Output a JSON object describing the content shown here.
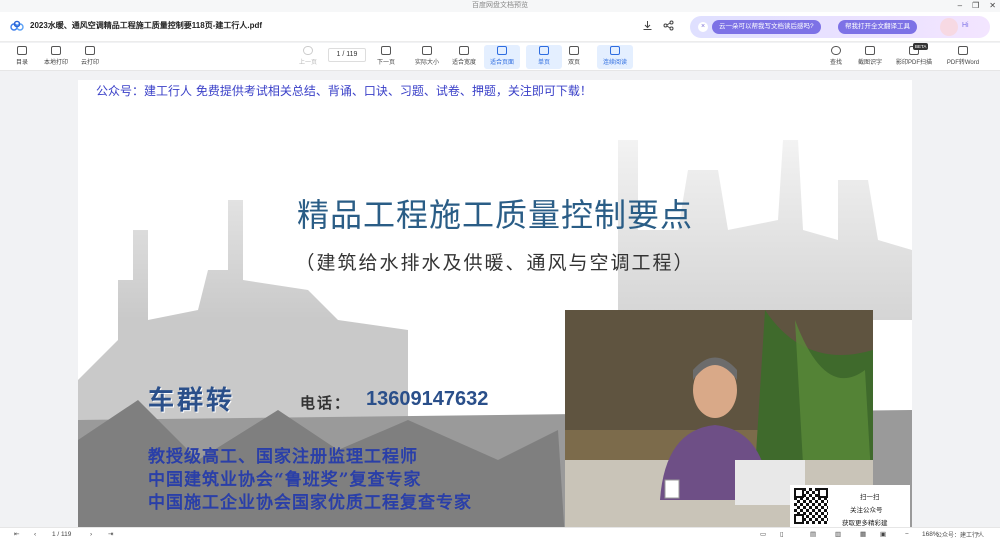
{
  "window": {
    "app_title": "百度网盘文档预览",
    "controls": [
      "–",
      "❐",
      "✕"
    ]
  },
  "document": {
    "title": "2023水暖、通风空调精品工程施工质量控制要118页-建工行人.pdf"
  },
  "ai_panel": {
    "close": "×",
    "chip1": "云一朵可以帮我写文档读后感吗?",
    "chip2": "帮我打开全文翻译工具",
    "greeting": "Hi"
  },
  "toolbar": {
    "left": [
      {
        "name": "catalog",
        "label": "目录"
      },
      {
        "name": "local-print",
        "label": "本地打印"
      },
      {
        "name": "cloud-print",
        "label": "云打印"
      }
    ],
    "prev_page": "上一页",
    "page_input": "1 / 119",
    "next_page": "下一页",
    "actual_size": "实际大小",
    "fit_width": "适合宽度",
    "fit_page": "适合页面",
    "single_page": "单页",
    "double_page": "双页",
    "continuous": "连续阅读",
    "right": [
      {
        "name": "search",
        "label": "查找"
      },
      {
        "name": "ocr",
        "label": "截图识字"
      },
      {
        "name": "scan-print",
        "label": "影印PDF扫描"
      },
      {
        "name": "pdf-to-word",
        "label": "PDF转Word"
      }
    ],
    "beta": "BETA"
  },
  "page": {
    "banner": "公众号：建工行人 免费提供考试相关总结、背诵、口诀、习题、试卷、押题，关注即可下载！",
    "main_title": "精品工程施工质量控制要点",
    "sub_title": "（建筑给水排水及供暖、通风与空调工程）",
    "person_name": "车群转",
    "phone_label": "电话：",
    "phone": "13609147632",
    "credentials": [
      "教授级高工、国家注册监理工程师",
      "中国建筑业协会“鲁班奖”复查专家",
      "中国施工企业协会国家优质工程复查专家"
    ]
  },
  "qr_card": {
    "line1": "扫一扫",
    "line2": "关注公众号",
    "line3": "获取更多精彩建"
  },
  "corner_tag": "公众号：建工行人",
  "statusbar": {
    "page_indicator": "1 / 119",
    "zoom": "168%"
  }
}
